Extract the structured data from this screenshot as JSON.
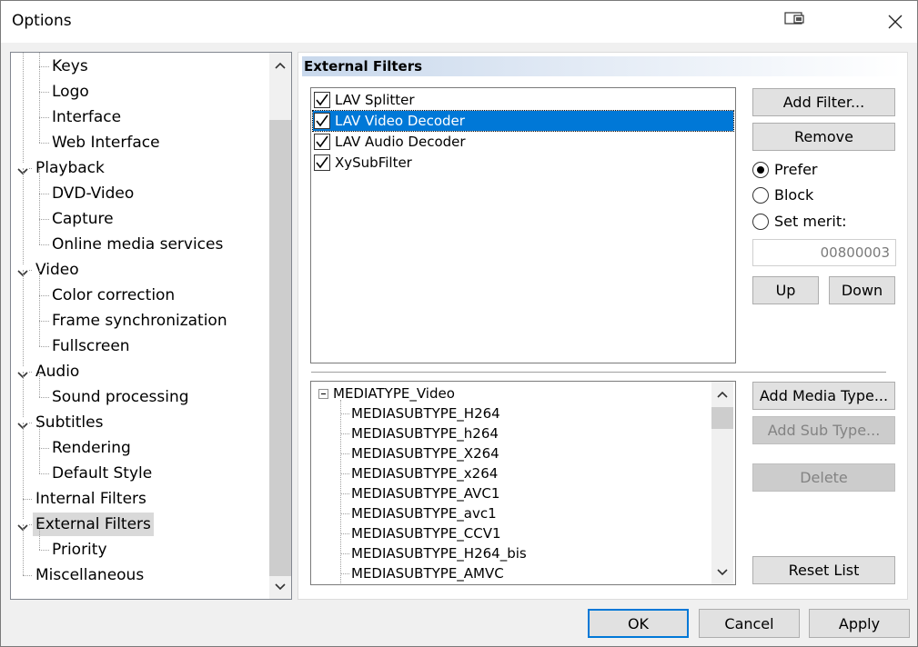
{
  "window": {
    "title": "Options",
    "restore_icon": "restore-window-icon",
    "close_icon": "close-icon"
  },
  "tree": {
    "items": [
      {
        "label": "Keys",
        "level": 2
      },
      {
        "label": "Logo",
        "level": 2
      },
      {
        "label": "Interface",
        "level": 2
      },
      {
        "label": "Web Interface",
        "level": 2
      },
      {
        "label": "Playback",
        "level": 1,
        "expanded": true
      },
      {
        "label": "DVD-Video",
        "level": 2
      },
      {
        "label": "Capture",
        "level": 2
      },
      {
        "label": "Online media services",
        "level": 2
      },
      {
        "label": "Video",
        "level": 1,
        "expanded": true
      },
      {
        "label": "Color correction",
        "level": 2
      },
      {
        "label": "Frame synchronization",
        "level": 2
      },
      {
        "label": "Fullscreen",
        "level": 2
      },
      {
        "label": "Audio",
        "level": 1,
        "expanded": true
      },
      {
        "label": "Sound processing",
        "level": 2
      },
      {
        "label": "Subtitles",
        "level": 1,
        "expanded": true
      },
      {
        "label": "Rendering",
        "level": 2
      },
      {
        "label": "Default Style",
        "level": 2
      },
      {
        "label": "Internal Filters",
        "level": 1
      },
      {
        "label": "External Filters",
        "level": 1,
        "expanded": true,
        "selected": true
      },
      {
        "label": "Priority",
        "level": 2
      },
      {
        "label": "Miscellaneous",
        "level": 1
      }
    ]
  },
  "page": {
    "header": "External Filters",
    "filters": [
      {
        "label": "LAV Splitter",
        "checked": true
      },
      {
        "label": "LAV Video Decoder",
        "checked": true,
        "selected": true
      },
      {
        "label": "LAV Audio Decoder",
        "checked": true
      },
      {
        "label": "XySubFilter",
        "checked": true
      }
    ],
    "buttons": {
      "add_filter": "Add Filter...",
      "remove": "Remove",
      "up": "Up",
      "down": "Down",
      "add_media_type": "Add Media Type...",
      "add_sub_type": "Add Sub Type...",
      "delete": "Delete",
      "reset_list": "Reset List"
    },
    "merit": {
      "prefer": "Prefer",
      "block": "Block",
      "set_merit": "Set merit:",
      "selected": "prefer",
      "value": "00800003"
    },
    "media_types": {
      "root": "MEDIATYPE_Video",
      "subtypes": [
        "MEDIASUBTYPE_H264",
        "MEDIASUBTYPE_h264",
        "MEDIASUBTYPE_X264",
        "MEDIASUBTYPE_x264",
        "MEDIASUBTYPE_AVC1",
        "MEDIASUBTYPE_avc1",
        "MEDIASUBTYPE_CCV1",
        "MEDIASUBTYPE_H264_bis",
        "MEDIASUBTYPE_AMVC"
      ]
    }
  },
  "footer": {
    "ok": "OK",
    "cancel": "Cancel",
    "apply": "Apply"
  },
  "colors": {
    "selection": "#0078d7",
    "tree_selection": "#d9d9d9"
  }
}
